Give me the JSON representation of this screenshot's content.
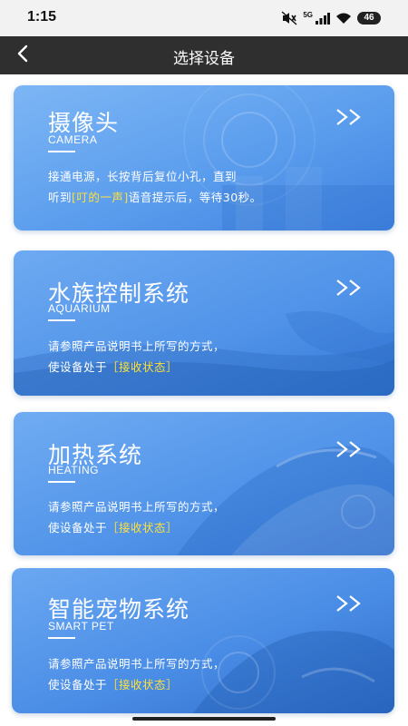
{
  "status_bar": {
    "time": "1:15",
    "network": "5G",
    "battery": "46"
  },
  "nav": {
    "title": "选择设备",
    "back_icon": "chevron-left-icon"
  },
  "cards": [
    {
      "title": "摄像头",
      "subtitle": "CAMERA",
      "desc_line1": "接通电源，长按背后复位小孔，直到",
      "desc_line2_pre": "听到",
      "desc_line2_highlight": "[叮的一声]",
      "desc_line2_post": "语音提示后，等待30秒。",
      "arrow": ">>"
    },
    {
      "title": "水族控制系统",
      "subtitle": "AQUARIUM",
      "desc_line1": "请参照产品说明书上所写的方式，",
      "desc_line2_pre": "使设备处于",
      "desc_line2_highlight": "［接收状态］",
      "desc_line2_post": "",
      "arrow": ">>"
    },
    {
      "title": "加热系统",
      "subtitle": "HEATING",
      "desc_line1": "请参照产品说明书上所写的方式，",
      "desc_line2_pre": "使设备处于",
      "desc_line2_highlight": "［接收状态］",
      "desc_line2_post": "",
      "arrow": ">>"
    },
    {
      "title": "智能宠物系统",
      "subtitle": "SMART PET",
      "desc_line1": "请参照产品说明书上所写的方式，",
      "desc_line2_pre": "使设备处于",
      "desc_line2_highlight": "［接收状态］",
      "desc_line2_post": "",
      "arrow": ">>"
    }
  ],
  "colors": {
    "nav_bg": "#2f2f2f",
    "card_blue_light": "#6aa9f2",
    "card_blue_dark": "#3f82e0",
    "highlight": "#ffe03a"
  }
}
